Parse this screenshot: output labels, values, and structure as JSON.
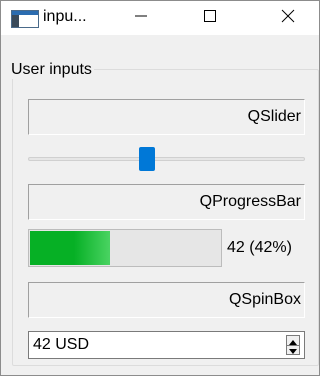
{
  "window": {
    "title": "inpu...",
    "icon": "app-window-icon",
    "controls": {
      "minimize_icon": "minimize-icon",
      "maximize_icon": "maximize-icon",
      "close_icon": "close-icon"
    }
  },
  "group": {
    "title": "User inputs"
  },
  "labels": {
    "slider": "QSlider",
    "progress": "QProgressBar",
    "spinbox": "QSpinBox"
  },
  "slider": {
    "value_fraction": 0.42,
    "accent": "#0078d7"
  },
  "progress": {
    "value": 42,
    "text": "42 (42%)",
    "fill_color": "#06b025"
  },
  "spinbox": {
    "value": "42 USD"
  }
}
